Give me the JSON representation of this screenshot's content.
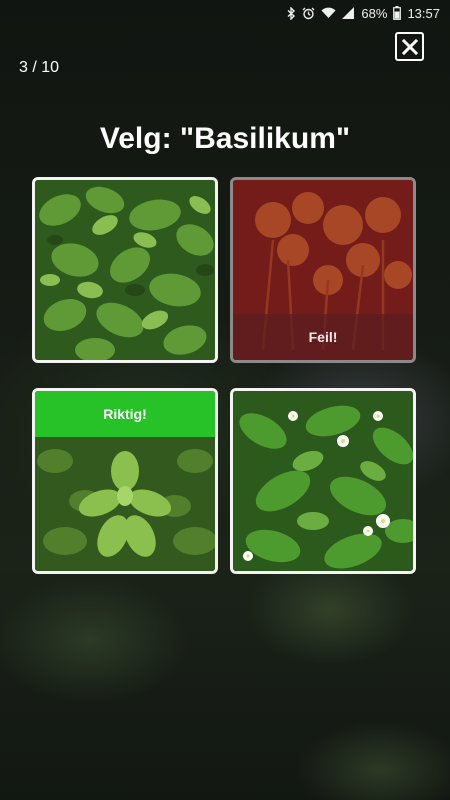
{
  "status_bar": {
    "battery_percent": "68%",
    "time": "13:57",
    "icons": [
      "bluetooth-icon",
      "alarm-icon",
      "wifi-icon",
      "signal-icon",
      "battery-icon"
    ]
  },
  "quiz": {
    "progress": "3 / 10",
    "question": "Velg: \"Basilikum\"",
    "close_icon": "close-icon"
  },
  "tiles": [
    {
      "result": ""
    },
    {
      "result": "Feil!"
    },
    {
      "result": "Riktig!"
    },
    {
      "result": ""
    }
  ],
  "colors": {
    "correct": "#27c227",
    "wrong": "#a01e1e",
    "text": "#ffffff"
  }
}
